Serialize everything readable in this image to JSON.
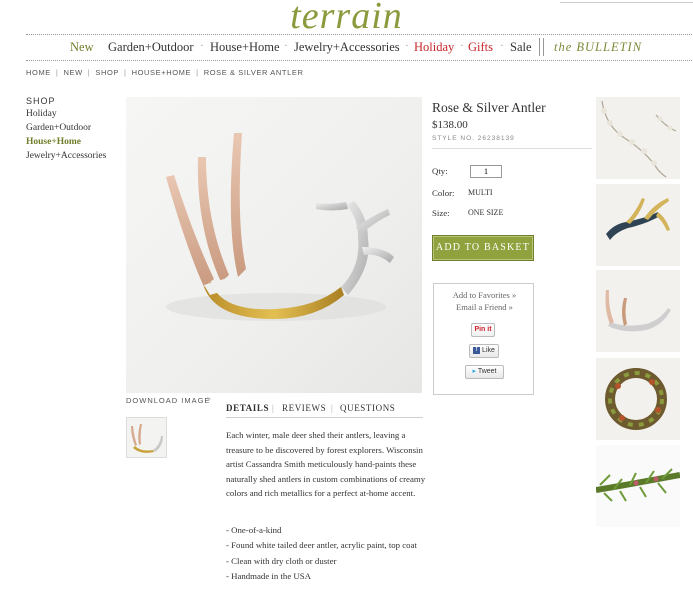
{
  "brand": {
    "logo": "terrain"
  },
  "nav": {
    "items": [
      "New",
      "Garden+Outdoor",
      "House+Home",
      "Jewelry+Accessories",
      "Holiday",
      "Gifts",
      "Sale",
      "the BULLETIN"
    ]
  },
  "breadcrumb": [
    "HOME",
    "NEW",
    "SHOP",
    "HOUSE+HOME",
    "ROSE & SILVER ANTLER"
  ],
  "sidebar": {
    "title": "SHOP",
    "items": [
      "Holiday",
      "Garden+Outdoor",
      "House+Home",
      "Jewelry+Accessories"
    ],
    "active": "House+Home"
  },
  "product": {
    "name": "Rose & Silver Antler",
    "price": "$138.00",
    "style": "STYLE NO. 26238139",
    "qty_label": "Qty:",
    "qty_value": "1",
    "color_label": "Color:",
    "color_value": "MULTI",
    "size_label": "Size:",
    "size_value": "ONE SIZE",
    "add_button": "ADD TO BASKET",
    "add_to_favorites": "Add to Favorites »",
    "email_friend": "Email a Friend »",
    "pin_it": "Pin it",
    "like": "Like",
    "tweet": "Tweet",
    "download_image": "DOWNLOAD IMAGE"
  },
  "tabs": [
    "DETAILS",
    "REVIEWS",
    "QUESTIONS"
  ],
  "description": "Each winter, male deer shed their antlers, leaving a treasure to be discovered by forest explorers. Wisconsin artist Cassandra Smith meticulously hand-paints these naturally shed antlers in custom combinations of creamy colors and rich metallics for a perfect at-home accent.",
  "bullets": [
    "- One-of-a-kind",
    "- Found white tailed deer antler, acrylic paint, top coat",
    "- Clean with dry cloth or duster",
    "- Handmade in the USA"
  ],
  "colors": {
    "brand_green": "#8a9a3c",
    "nav_red": "#c8262b",
    "button_green": "#8fa23d"
  },
  "icons": {
    "download": "arrow-icon",
    "facebook": "facebook-icon",
    "twitter": "twitter-icon"
  }
}
